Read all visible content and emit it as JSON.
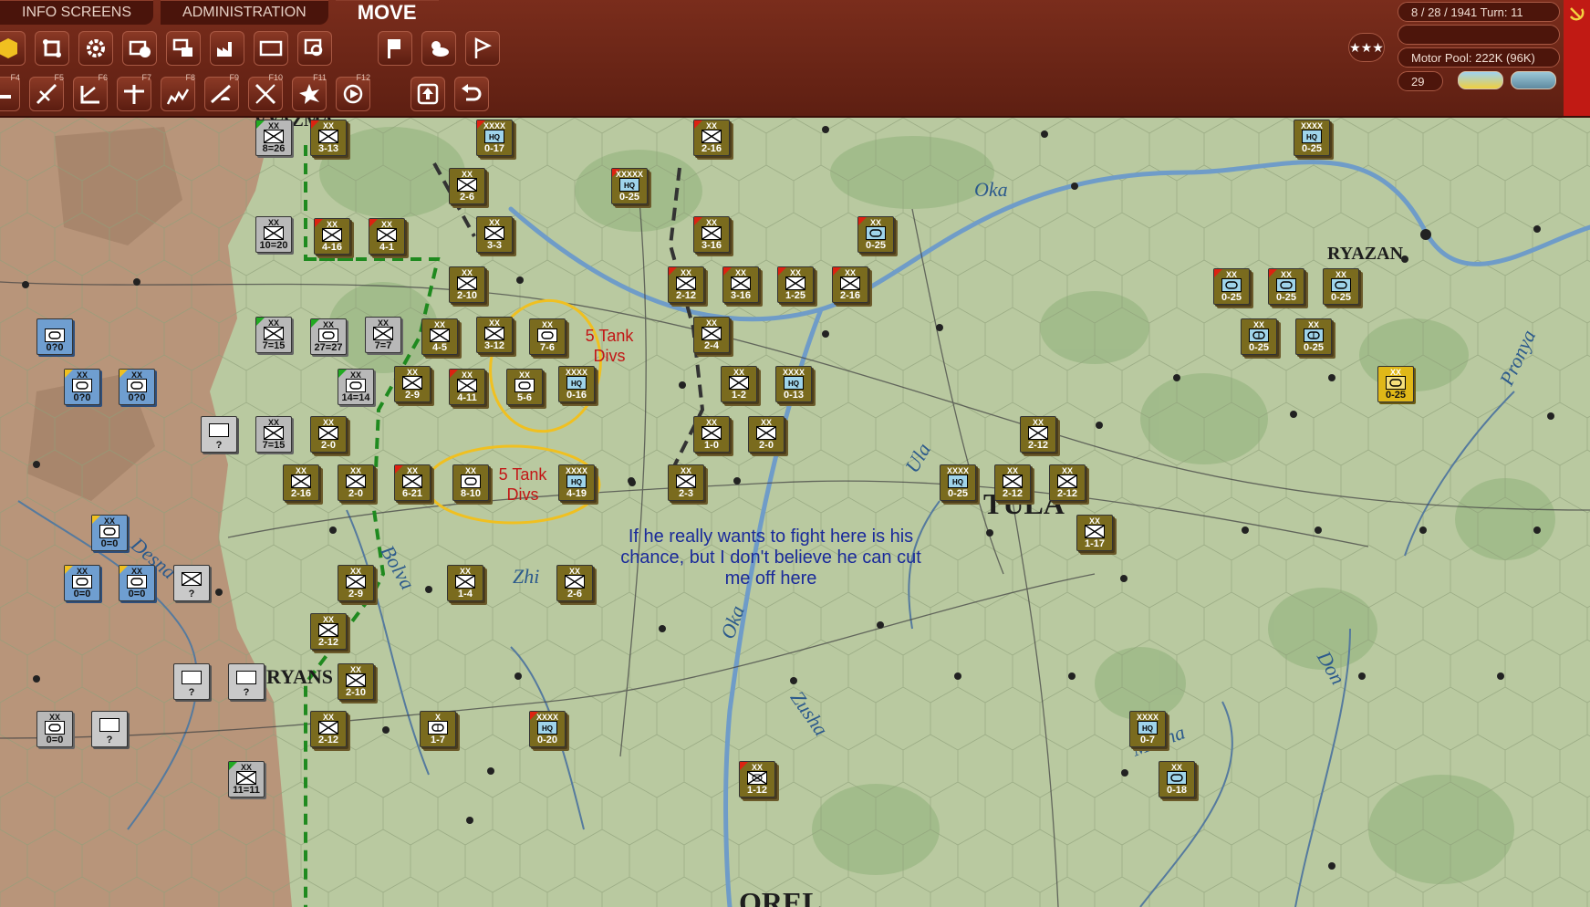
{
  "tabs": [
    {
      "label": "INFO SCREENS",
      "active": false
    },
    {
      "label": "ADMINISTRATION",
      "active": false
    },
    {
      "label": "MOVE",
      "active": true
    }
  ],
  "toolbar_row1": [
    "hex-icon",
    "supply-icon",
    "gear-icon",
    "camera-icon",
    "overlay-icon",
    "factory-icon",
    "frame-icon",
    "zoom-icon",
    "flag-icon",
    "weather-icon",
    "pennant-icon"
  ],
  "toolbar_row2": [
    {
      "icon": "ground-icon",
      "fkey": "F4"
    },
    {
      "icon": "air-strike-icon",
      "fkey": "F5"
    },
    {
      "icon": "air-transfer-icon",
      "fkey": "F6"
    },
    {
      "icon": "air-recon-icon",
      "fkey": "F7"
    },
    {
      "icon": "air-supply-icon",
      "fkey": "F8"
    },
    {
      "icon": "paradrop-icon",
      "fkey": "F9"
    },
    {
      "icon": "interdict-icon",
      "fkey": "F10"
    },
    {
      "icon": "explosion-icon",
      "fkey": "F11"
    },
    {
      "icon": "target-icon",
      "fkey": "F12"
    },
    {
      "icon": "upload-icon",
      "fkey": ""
    },
    {
      "icon": "undo-icon",
      "fkey": ""
    }
  ],
  "status": {
    "date_turn": "8 / 28 / 1941  Turn: 11",
    "blank": "",
    "motor_pool": "Motor Pool:  222K (96K)",
    "counter": "29",
    "rank_stars": "★★★"
  },
  "colors": {
    "bar": "#6a2416",
    "soviet_red": "#c11a14",
    "axis_olive": "#7a6b1e",
    "soviet_grey": "#b8b8b8",
    "soviet_blue": "#6f9ed0",
    "annotation_red": "#c21616",
    "comment_blue": "#1a2a9a",
    "circle_yellow": "#f0c020",
    "front_green": "#1f8a1f"
  },
  "cities": [
    "VYAZMA",
    "RYAZAN",
    "TULA",
    "RYANS",
    "OREL"
  ],
  "rivers": [
    "Oka",
    "Ula",
    "Desna",
    "Bolva",
    "Zhi",
    "Oka",
    "Zusha",
    "Don",
    "Pronya",
    "Mecha"
  ],
  "annotations": [
    {
      "text": "5 Tank Divs"
    },
    {
      "text": "5 Tank Divs"
    }
  ],
  "comment": "If he really wants to fight here is his chance, but I don't believe he can cut me off here",
  "units": [
    {
      "side": "grey",
      "size": "XX",
      "type": "inf",
      "val": "8=26",
      "flag": "green"
    },
    {
      "side": "olive",
      "size": "XX",
      "type": "inf",
      "val": "3-13",
      "flag": "red"
    },
    {
      "side": "olive",
      "size": "XXXX",
      "type": "hq",
      "val": "0-17",
      "flag": "red"
    },
    {
      "side": "olive",
      "size": "XX",
      "type": "inf",
      "val": "2-6"
    },
    {
      "side": "olive",
      "size": "XXXXX",
      "type": "hq",
      "val": "0-25",
      "flag": "red"
    },
    {
      "side": "olive",
      "size": "XX",
      "type": "inf",
      "val": "2-16",
      "flag": "red"
    },
    {
      "side": "olive",
      "size": "XXXX",
      "type": "hq",
      "val": "0-25"
    },
    {
      "side": "grey",
      "size": "XX",
      "type": "inf",
      "val": "10=20"
    },
    {
      "side": "olive",
      "size": "XX",
      "type": "inf",
      "val": "4-16",
      "flag": "red"
    },
    {
      "side": "olive",
      "size": "XX",
      "type": "inf",
      "val": "4-1",
      "flag": "red"
    },
    {
      "side": "olive",
      "size": "XX",
      "type": "inf",
      "val": "3-3"
    },
    {
      "side": "olive",
      "size": "XX",
      "type": "inf",
      "val": "3-16",
      "flag": "red"
    },
    {
      "side": "olive",
      "size": "XX",
      "type": "armor",
      "val": "0-25",
      "flag": "red"
    },
    {
      "side": "olive",
      "size": "XX",
      "type": "inf",
      "val": "2-10"
    },
    {
      "side": "olive",
      "size": "XX",
      "type": "inf",
      "val": "2-12",
      "flag": "red"
    },
    {
      "side": "olive",
      "size": "XX",
      "type": "inf",
      "val": "3-16",
      "flag": "red"
    },
    {
      "side": "olive",
      "size": "XX",
      "type": "inf",
      "val": "1-25",
      "flag": "red"
    },
    {
      "side": "olive",
      "size": "XX",
      "type": "inf",
      "val": "2-16",
      "flag": "red"
    },
    {
      "side": "olive",
      "size": "XX",
      "type": "armor",
      "val": "0-25",
      "flag": "red"
    },
    {
      "side": "olive",
      "size": "XX",
      "type": "armor",
      "val": "0-25",
      "flag": "red"
    },
    {
      "side": "olive",
      "size": "XX",
      "type": "armor",
      "val": "0-25"
    },
    {
      "side": "blue",
      "size": "",
      "type": "armor",
      "val": "0?0"
    },
    {
      "side": "grey",
      "size": "XX",
      "type": "inf",
      "val": "7=15",
      "flag": "green"
    },
    {
      "side": "grey",
      "size": "XX",
      "type": "armor",
      "val": "27=27",
      "flag": "green"
    },
    {
      "side": "grey",
      "size": "XX",
      "type": "inf",
      "val": "7=7"
    },
    {
      "side": "olive",
      "size": "XX",
      "type": "inf",
      "val": "4-5"
    },
    {
      "side": "olive",
      "size": "XX",
      "type": "inf",
      "val": "3-12"
    },
    {
      "side": "olive",
      "size": "XX",
      "type": "armor",
      "val": "7-6"
    },
    {
      "side": "olive",
      "size": "XX",
      "type": "inf",
      "val": "2-4"
    },
    {
      "side": "olive",
      "size": "XX",
      "type": "motor",
      "val": "0-25"
    },
    {
      "side": "olive",
      "size": "XX",
      "type": "motor",
      "val": "0-25"
    },
    {
      "side": "blue",
      "size": "XX",
      "type": "armor",
      "val": "0?0",
      "flag": "gold"
    },
    {
      "side": "blue",
      "size": "XX",
      "type": "armor",
      "val": "0?0",
      "flag": "gold"
    },
    {
      "side": "grey",
      "size": "XX",
      "type": "armor",
      "val": "14=14",
      "flag": "green"
    },
    {
      "side": "olive",
      "size": "XX",
      "type": "inf",
      "val": "2-9"
    },
    {
      "side": "olive",
      "size": "XX",
      "type": "inf",
      "val": "4-11",
      "flag": "red"
    },
    {
      "side": "olive",
      "size": "XX",
      "type": "armor",
      "val": "5-6"
    },
    {
      "side": "olive",
      "size": "XXXX",
      "type": "hq",
      "val": "0-16"
    },
    {
      "side": "olive",
      "size": "XX",
      "type": "inf",
      "val": "1-2"
    },
    {
      "side": "olive",
      "size": "XXXX",
      "type": "hq",
      "val": "0-13"
    },
    {
      "side": "gold",
      "size": "XX",
      "type": "armor",
      "val": "0-25"
    },
    {
      "side": "mystery",
      "size": "",
      "type": "blank",
      "val": "?"
    },
    {
      "side": "grey",
      "size": "XX",
      "type": "inf",
      "val": "7=15"
    },
    {
      "side": "olive",
      "size": "XX",
      "type": "inf",
      "val": "2-0"
    },
    {
      "side": "olive",
      "size": "XX",
      "type": "inf",
      "val": "1-0"
    },
    {
      "side": "olive",
      "size": "XX",
      "type": "inf",
      "val": "2-0"
    },
    {
      "side": "olive",
      "size": "XX",
      "type": "inf",
      "val": "2-12"
    },
    {
      "side": "olive",
      "size": "XX",
      "type": "inf",
      "val": "2-16"
    },
    {
      "side": "olive",
      "size": "XX",
      "type": "inf",
      "val": "2-0"
    },
    {
      "side": "olive",
      "size": "XX",
      "type": "inf",
      "val": "6-21",
      "flag": "red"
    },
    {
      "side": "olive",
      "size": "XX",
      "type": "armor",
      "val": "8-10"
    },
    {
      "side": "olive",
      "size": "XXXX",
      "type": "hq",
      "val": "4-19"
    },
    {
      "side": "olive",
      "size": "XX",
      "type": "inf",
      "val": "2-3"
    },
    {
      "side": "olive",
      "size": "XXXX",
      "type": "hq",
      "val": "0-25"
    },
    {
      "side": "olive",
      "size": "XX",
      "type": "inf",
      "val": "2-12"
    },
    {
      "side": "olive",
      "size": "XX",
      "type": "inf",
      "val": "2-12"
    },
    {
      "side": "olive",
      "size": "XX",
      "type": "inf",
      "val": "1-17"
    },
    {
      "side": "blue",
      "size": "XX",
      "type": "armor",
      "val": "0=0",
      "flag": "gold"
    },
    {
      "side": "blue",
      "size": "XX",
      "type": "armor",
      "val": "0=0",
      "flag": "gold"
    },
    {
      "side": "blue",
      "size": "XX",
      "type": "armor",
      "val": "0=0",
      "flag": "gold"
    },
    {
      "side": "mystery",
      "size": "",
      "type": "inf",
      "val": "?"
    },
    {
      "side": "olive",
      "size": "XX",
      "type": "inf",
      "val": "2-9"
    },
    {
      "side": "olive",
      "size": "XX",
      "type": "inf",
      "val": "1-4"
    },
    {
      "side": "olive",
      "size": "XX",
      "type": "inf",
      "val": "2-6"
    },
    {
      "side": "olive",
      "size": "XX",
      "type": "inf",
      "val": "2-12"
    },
    {
      "side": "mystery",
      "size": "",
      "type": "blank",
      "val": "?"
    },
    {
      "side": "mystery",
      "size": "",
      "type": "blank",
      "val": "?"
    },
    {
      "side": "olive",
      "size": "XX",
      "type": "inf",
      "val": "2-10"
    },
    {
      "side": "grey",
      "size": "XX",
      "type": "armor",
      "val": "0=0"
    },
    {
      "side": "mystery",
      "size": "",
      "type": "blank",
      "val": "?"
    },
    {
      "side": "olive",
      "size": "XX",
      "type": "inf",
      "val": "2-12"
    },
    {
      "side": "olive",
      "size": "X",
      "type": "motor",
      "val": "1-7"
    },
    {
      "side": "olive",
      "size": "XXXX",
      "type": "hq",
      "val": "0-20",
      "flag": "red"
    },
    {
      "side": "olive",
      "size": "XXXX",
      "type": "hq",
      "val": "0-7"
    },
    {
      "side": "grey",
      "size": "XX",
      "type": "inf",
      "val": "11=11",
      "flag": "green"
    },
    {
      "side": "olive",
      "size": "XX",
      "type": "mech",
      "val": "1-12",
      "flag": "red"
    },
    {
      "side": "olive",
      "size": "XX",
      "type": "armor",
      "val": "0-18"
    }
  ]
}
